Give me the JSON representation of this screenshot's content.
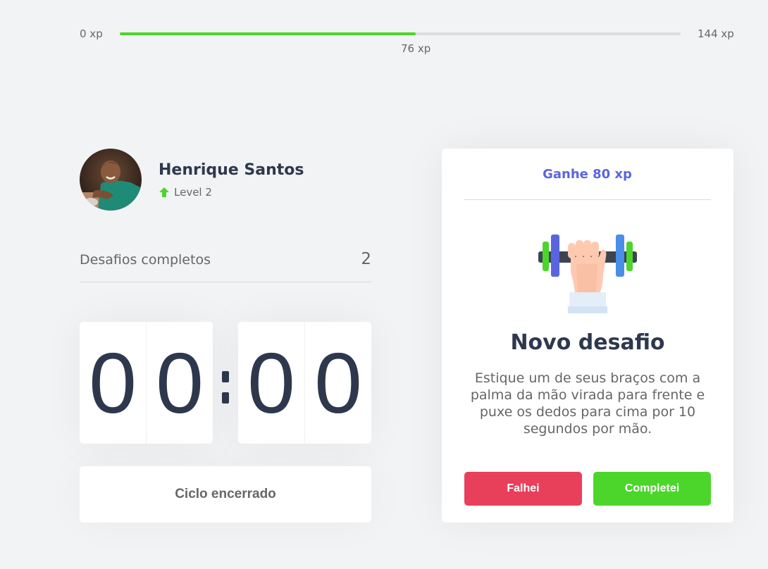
{
  "xp": {
    "min_label": "0 xp",
    "max_label": "144 xp",
    "current_label": "76 xp",
    "current": 76,
    "max": 144,
    "fill_color": "#4cd62b"
  },
  "profile": {
    "name": "Henrique Santos",
    "level_label": "Level 2",
    "level_icon": "level-up-arrow-icon"
  },
  "completed": {
    "label": "Desafios completos",
    "value": "2"
  },
  "countdown": {
    "minutes": [
      "0",
      "0"
    ],
    "seconds": [
      "0",
      "0"
    ]
  },
  "cycle_button": {
    "label": "Ciclo encerrado"
  },
  "challenge": {
    "header": "Ganhe 80 xp",
    "icon": "dumbbell-body-icon",
    "title": "Novo desafio",
    "description": "Estique um de seus braços com a palma da mão virada para frente e puxe os dedos para cima por 10 segundos por mão.",
    "fail_label": "Falhei",
    "success_label": "Completei"
  },
  "colors": {
    "blue": "#5965e0",
    "red": "#e83f5b",
    "green": "#4cd62b",
    "title": "#2e384d",
    "text": "#666666",
    "background": "#f2f3f5"
  }
}
